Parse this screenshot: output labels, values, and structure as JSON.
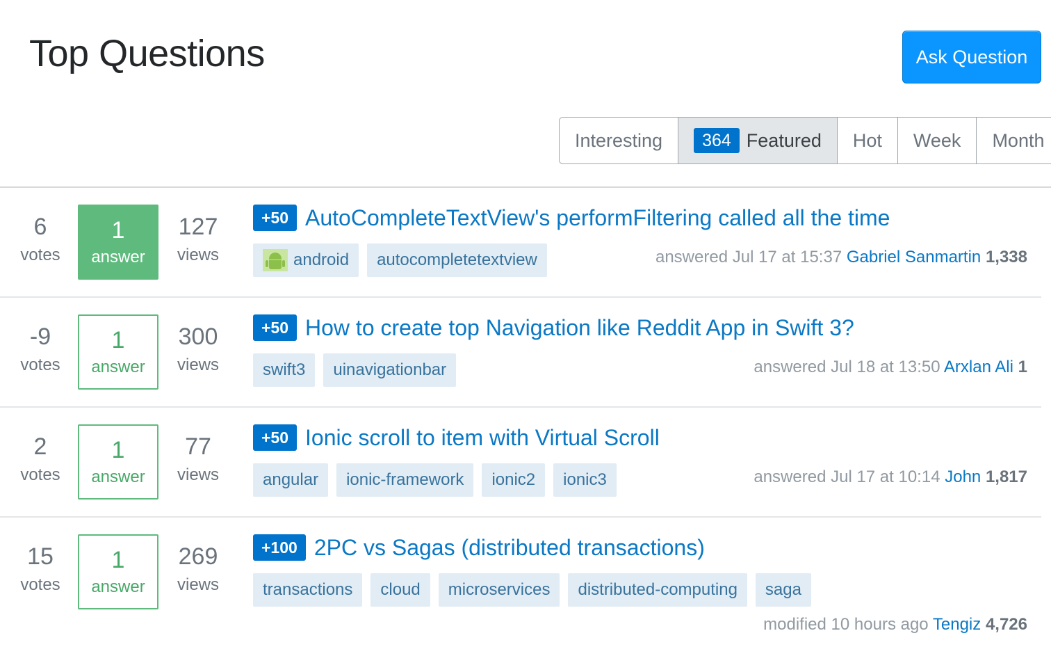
{
  "header": {
    "title": "Top Questions",
    "ask_button": "Ask Question"
  },
  "tabs": [
    {
      "label": "Interesting",
      "active": false
    },
    {
      "label": "Featured",
      "count": "364",
      "active": true
    },
    {
      "label": "Hot",
      "active": false
    },
    {
      "label": "Week",
      "active": false
    },
    {
      "label": "Month",
      "active": false
    }
  ],
  "questions": [
    {
      "votes": "6",
      "votes_label": "votes",
      "answers": "1",
      "answers_label": "answer",
      "accepted": true,
      "views": "127",
      "views_label": "views",
      "bounty": "+50",
      "title": "AutoCompleteTextView's performFiltering called all the time",
      "tags": [
        "android",
        "autocompletetextview"
      ],
      "activity": "answered Jul 17 at 15:37",
      "user": "Gabriel Sanmartin",
      "reputation": "1,338"
    },
    {
      "votes": "-9",
      "votes_label": "votes",
      "answers": "1",
      "answers_label": "answer",
      "accepted": false,
      "views": "300",
      "views_label": "views",
      "bounty": "+50",
      "title": "How to create top Navigation like Reddit App in Swift 3?",
      "tags": [
        "swift3",
        "uinavigationbar"
      ],
      "activity": "answered Jul 18 at 13:50",
      "user": "Arxlan Ali",
      "reputation": "1"
    },
    {
      "votes": "2",
      "votes_label": "votes",
      "answers": "1",
      "answers_label": "answer",
      "accepted": false,
      "views": "77",
      "views_label": "views",
      "bounty": "+50",
      "title": "Ionic scroll to item with Virtual Scroll",
      "tags": [
        "angular",
        "ionic-framework",
        "ionic2",
        "ionic3"
      ],
      "activity": "answered Jul 17 at 10:14",
      "user": "John",
      "reputation": "1,817"
    },
    {
      "votes": "15",
      "votes_label": "votes",
      "answers": "1",
      "answers_label": "answer",
      "accepted": false,
      "views": "269",
      "views_label": "views",
      "bounty": "+100",
      "title": "2PC vs Sagas (distributed transactions)",
      "tags": [
        "transactions",
        "cloud",
        "microservices",
        "distributed-computing",
        "saga"
      ],
      "activity": "modified 10 hours ago",
      "user": "Tengiz",
      "reputation": "4,726"
    }
  ],
  "colors": {
    "accent": "#0a95ff",
    "link": "#0a78c5",
    "bounty": "#0074cc",
    "accepted": "#5eba7d",
    "tag_bg": "#e1ecf4",
    "tag_text": "#39739d"
  },
  "icons": {
    "android_tag": "android-icon"
  }
}
